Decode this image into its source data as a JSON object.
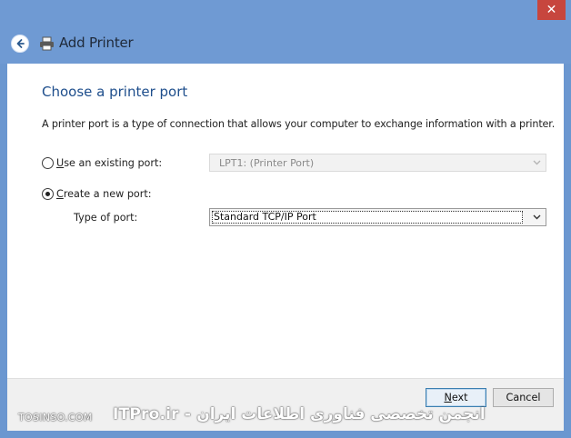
{
  "window": {
    "title": "Add Printer",
    "close_label": "✕"
  },
  "page": {
    "heading": "Choose a printer port",
    "description": "A printer port is a type of connection that allows your computer to exchange information with a printer."
  },
  "options": {
    "existing": {
      "label_underlined": "U",
      "label_rest": "se an existing port:",
      "selected": false,
      "value": "LPT1: (Printer Port)"
    },
    "new": {
      "label_underlined": "C",
      "label_rest": "reate a new port:",
      "selected": true
    },
    "type_label": "Type of port:",
    "type_value": "Standard TCP/IP Port"
  },
  "footer": {
    "next_underlined": "N",
    "next_rest": "ext",
    "cancel_label": "Cancel"
  },
  "watermark": {
    "left": "TOSINSO.COM",
    "right": "ITPro.ir - انجمن تخصصی فناوری اطلاعات ایران"
  },
  "colors": {
    "title_bar": "#6f9ad3",
    "heading": "#1e4e8c",
    "close_button": "#c7463e"
  }
}
